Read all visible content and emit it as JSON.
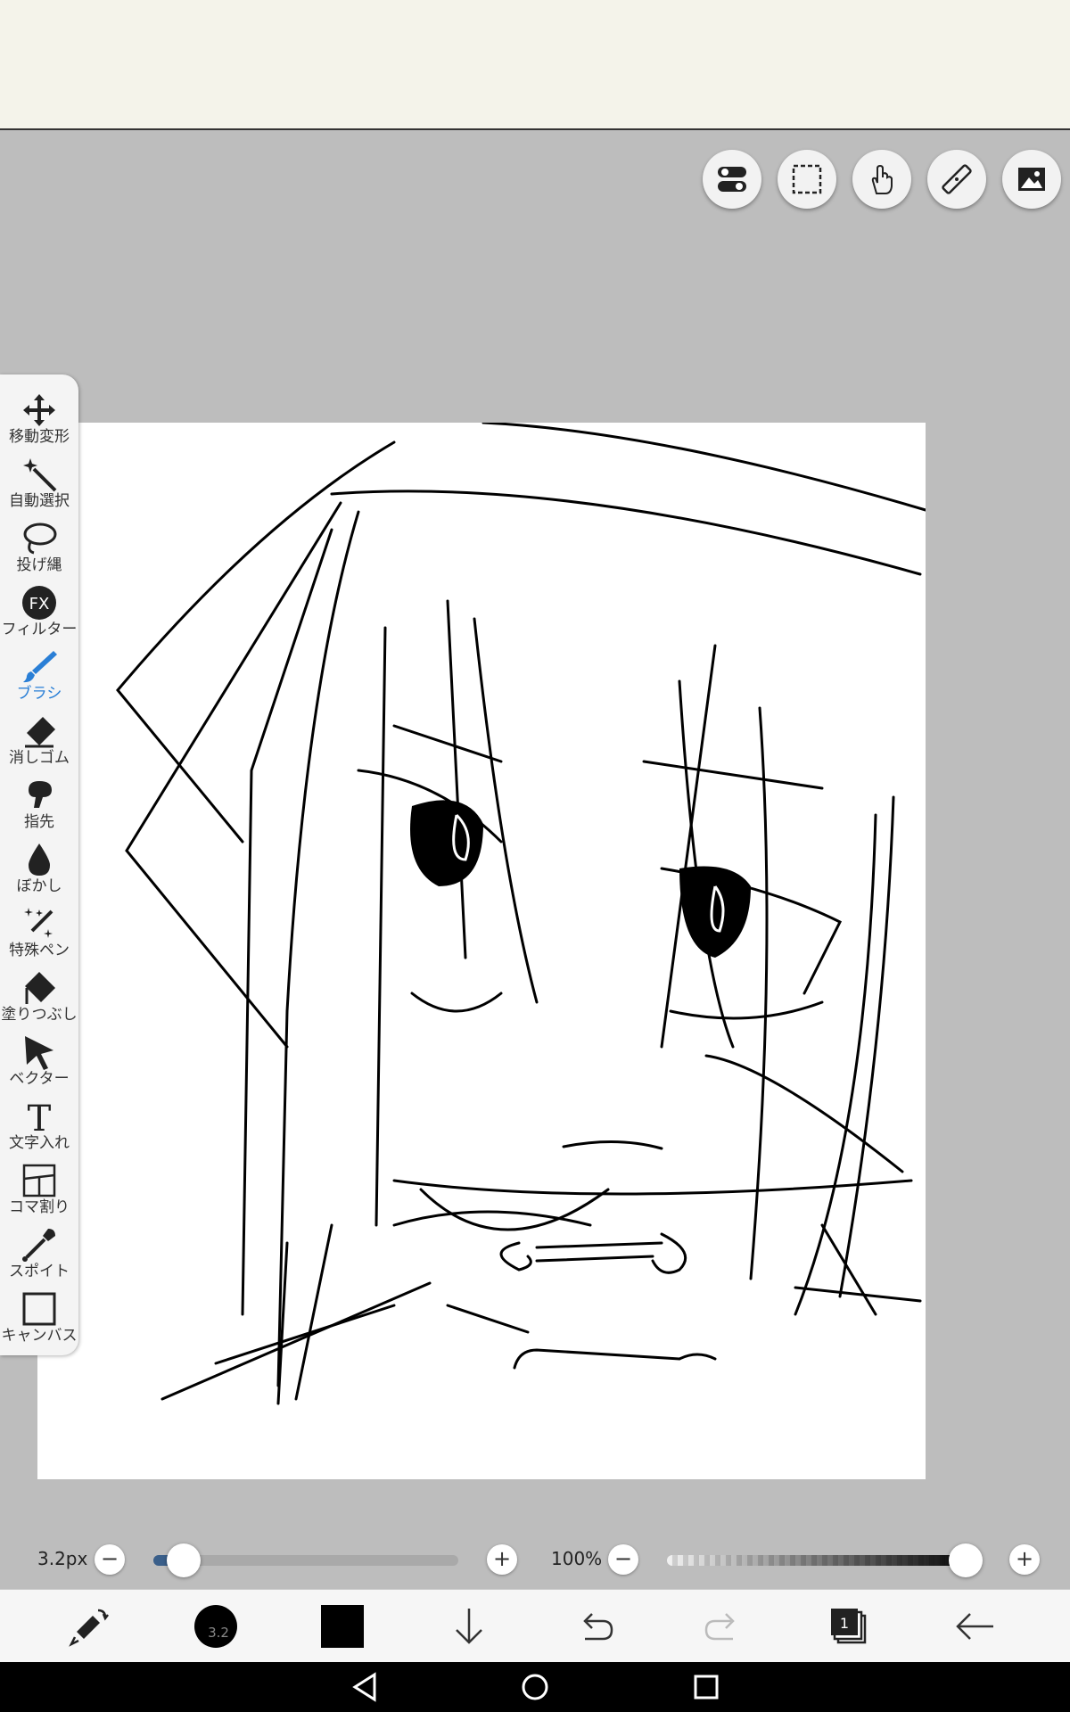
{
  "toolbar_top": {
    "buttons": [
      {
        "name": "toggle-settings-button",
        "icon": "toggle-icon"
      },
      {
        "name": "selection-button",
        "icon": "dashed-rect-icon"
      },
      {
        "name": "gesture-button",
        "icon": "hand-icon"
      },
      {
        "name": "ruler-button",
        "icon": "ruler-icon"
      },
      {
        "name": "image-button",
        "icon": "image-icon"
      }
    ]
  },
  "tools": [
    {
      "label": "移動変形",
      "icon": "move-icon"
    },
    {
      "label": "自動選択",
      "icon": "magic-wand-icon"
    },
    {
      "label": "投げ縄",
      "icon": "lasso-icon"
    },
    {
      "label": "フィルター",
      "icon": "fx-icon"
    },
    {
      "label": "ブラシ",
      "icon": "brush-icon",
      "active": true
    },
    {
      "label": "消しゴム",
      "icon": "eraser-icon"
    },
    {
      "label": "指先",
      "icon": "finger-icon"
    },
    {
      "label": "ぼかし",
      "icon": "blur-drop-icon"
    },
    {
      "label": "特殊ペン",
      "icon": "special-pen-icon"
    },
    {
      "label": "塗りつぶし",
      "icon": "bucket-icon"
    },
    {
      "label": "ベクター",
      "icon": "vector-arrow-icon"
    },
    {
      "label": "文字入れ",
      "icon": "text-icon"
    },
    {
      "label": "コマ割り",
      "icon": "panel-icon"
    },
    {
      "label": "スポイト",
      "icon": "eyedropper-icon"
    },
    {
      "label": "キャンバス",
      "icon": "canvas-icon"
    }
  ],
  "brush_size": {
    "label": "3.2px",
    "value": 3.2,
    "fraction": 0.1
  },
  "opacity": {
    "label": "100%",
    "value": 100,
    "fraction": 1.0
  },
  "bottom_bar": {
    "brush_size_badge": "3.2",
    "color": "#000000",
    "buttons": [
      "swap-tool-icon",
      "brush-size-icon",
      "color-swatch-icon",
      "down-arrow-icon",
      "undo-icon",
      "redo-icon",
      "layers-icon",
      "back-arrow-icon"
    ],
    "layer_count": "1"
  },
  "colors": {
    "accent": "#2a7fd6",
    "canvas": "#ffffff",
    "background": "#bdbdbd"
  }
}
